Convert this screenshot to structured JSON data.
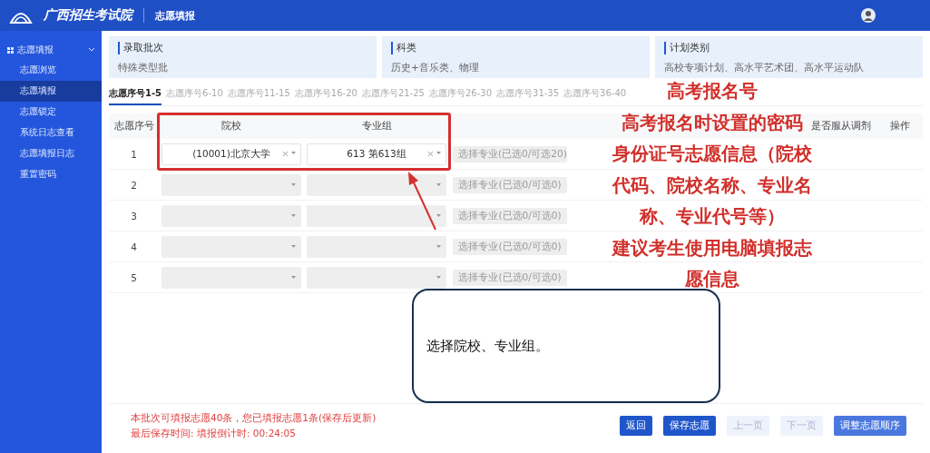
{
  "header": {
    "logo_text": "广西招生考试院",
    "page_title": "志愿填报"
  },
  "sidebar": {
    "group": {
      "label": "志愿填报",
      "expanded": true
    },
    "items": [
      {
        "label": "志愿浏览",
        "selected": false
      },
      {
        "label": "志愿填报",
        "selected": true
      },
      {
        "label": "志愿锁定",
        "selected": false
      },
      {
        "label": "系统日志查看",
        "selected": false
      },
      {
        "label": "志愿填报日志",
        "selected": false
      },
      {
        "label": "重置密码",
        "selected": false
      }
    ]
  },
  "info_cards": [
    {
      "label": "录取批次",
      "value": "特殊类型批"
    },
    {
      "label": "科类",
      "value": "历史+音乐类、物理"
    },
    {
      "label": "计划类别",
      "value": "高校专项计划、高水平艺术团、高水平运动队"
    }
  ],
  "tabs": [
    {
      "label": "志愿序号1-5",
      "selected": true
    },
    {
      "label": "志愿序号6-10",
      "selected": false
    },
    {
      "label": "志愿序号11-15",
      "selected": false
    },
    {
      "label": "志愿序号16-20",
      "selected": false
    },
    {
      "label": "志愿序号21-25",
      "selected": false
    },
    {
      "label": "志愿序号26-30",
      "selected": false
    },
    {
      "label": "志愿序号31-35",
      "selected": false
    },
    {
      "label": "志愿序号36-40",
      "selected": false
    }
  ],
  "table": {
    "columns": [
      "志愿序号",
      "院校",
      "专业组",
      "是否服从调剂",
      "操作"
    ],
    "rows": [
      {
        "number": "1",
        "school": "(10001)北京大学",
        "group": "613 第613组",
        "major_button": "选择专业(已选0/可选20)"
      },
      {
        "number": "2",
        "major_button": "选择专业(已选0/可选0)"
      },
      {
        "number": "3",
        "major_button": "选择专业(已选0/可选0)"
      },
      {
        "number": "4",
        "major_button": "选择专业(已选0/可选0)"
      },
      {
        "number": "5",
        "major_button": "选择专业(已选0/可选0)"
      }
    ]
  },
  "footer": {
    "notes": [
      "本批次可填报志愿40条，您已填报志愿1条(保存后更新)",
      "最后保存时间:  填报倒计时:  00:24:05"
    ],
    "buttons": [
      {
        "label": "返回",
        "disabled": false,
        "kind": "primary"
      },
      {
        "label": "保存志愿",
        "disabled": false,
        "kind": "primary"
      },
      {
        "label": "上一页",
        "disabled": true,
        "kind": "plain"
      },
      {
        "label": "下一页",
        "disabled": true,
        "kind": "plain"
      },
      {
        "label": "调整志愿顺序",
        "disabled": false,
        "kind": "light"
      }
    ]
  },
  "annotation": {
    "lines": [
      "高考报名号",
      "高考报名时设置的密码",
      "身份证号志愿信息（院校",
      "代码、院校名称、专业名",
      "称、专业代号等）",
      "建议考生使用电脑填报志",
      "愿信息"
    ],
    "callout": "选择院校、专业组。"
  }
}
